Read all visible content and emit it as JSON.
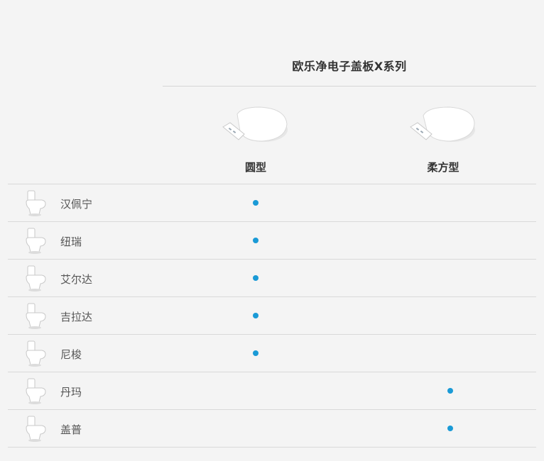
{
  "header": {
    "series_title": "欧乐净电子盖板X系列",
    "columns": [
      {
        "label": "圆型",
        "icon": "round-seat-icon"
      },
      {
        "label": "柔方型",
        "icon": "soft-square-seat-icon"
      }
    ]
  },
  "rows": [
    {
      "name": "汉佩宁",
      "icon": "toilet-icon",
      "compat": [
        true,
        false
      ]
    },
    {
      "name": "纽瑞",
      "icon": "toilet-icon",
      "compat": [
        true,
        false
      ]
    },
    {
      "name": "艾尔达",
      "icon": "toilet-icon",
      "compat": [
        true,
        false
      ]
    },
    {
      "name": "吉拉达",
      "icon": "toilet-icon",
      "compat": [
        true,
        false
      ]
    },
    {
      "name": "尼梭",
      "icon": "toilet-icon",
      "compat": [
        true,
        false
      ]
    },
    {
      "name": "丹玛",
      "icon": "toilet-icon",
      "compat": [
        false,
        true
      ]
    },
    {
      "name": "盖普",
      "icon": "toilet-icon",
      "compat": [
        false,
        true
      ]
    }
  ],
  "colors": {
    "accent_dot": "#1a9ad6",
    "background": "#f4f4f4",
    "divider": "#d9d9d9"
  }
}
